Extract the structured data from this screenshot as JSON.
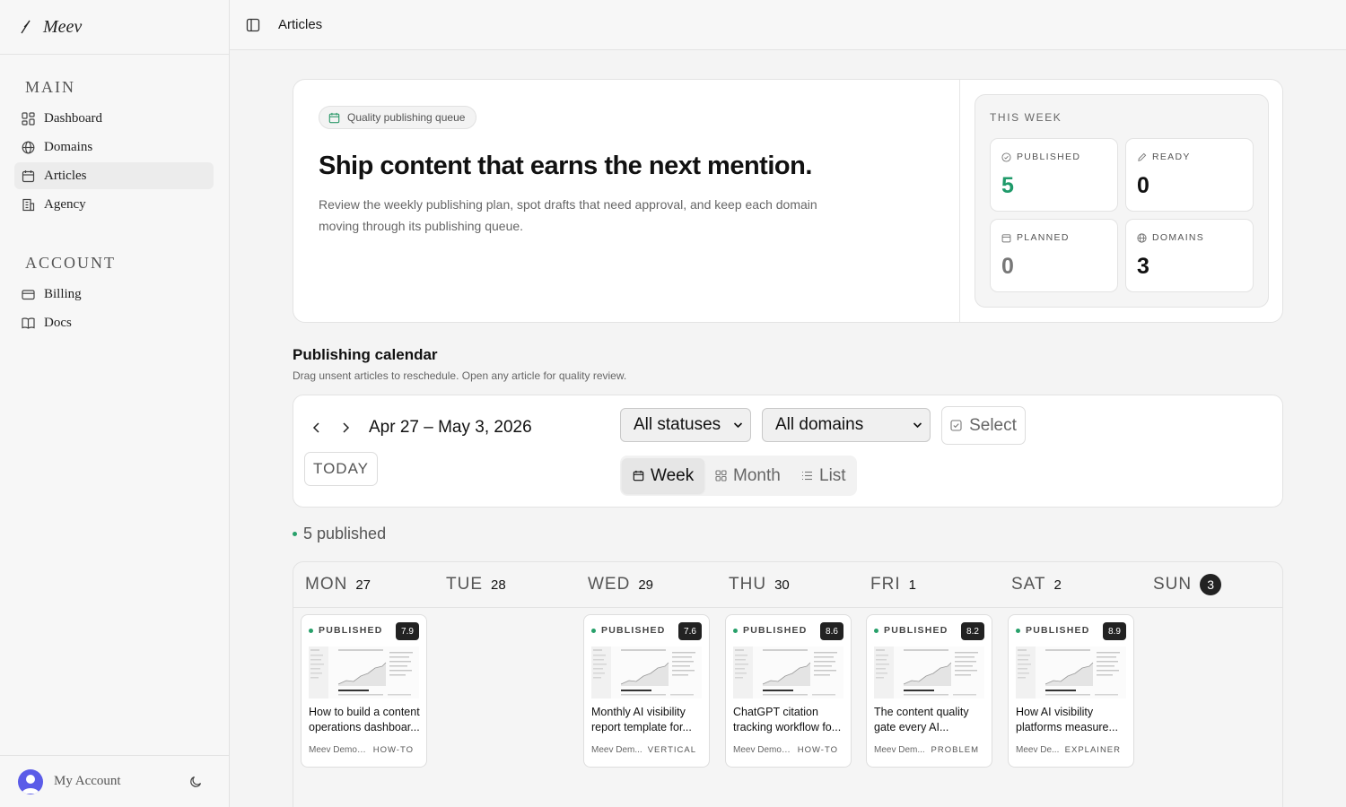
{
  "brand": {
    "name": "Meev"
  },
  "sidebar": {
    "sections": [
      {
        "title": "MAIN",
        "items": [
          {
            "label": "Dashboard",
            "icon": "dashboard-icon"
          },
          {
            "label": "Domains",
            "icon": "globe-icon"
          },
          {
            "label": "Articles",
            "icon": "calendar-icon",
            "active": true
          },
          {
            "label": "Agency",
            "icon": "building-icon"
          }
        ]
      },
      {
        "title": "ACCOUNT",
        "items": [
          {
            "label": "Billing",
            "icon": "credit-card-icon"
          },
          {
            "label": "Docs",
            "icon": "book-icon"
          }
        ]
      }
    ],
    "account_label": "My Account"
  },
  "topbar": {
    "title": "Articles"
  },
  "hero": {
    "badge": "Quality publishing queue",
    "title": "Ship content that earns the next mention.",
    "description": "Review the weekly publishing plan, spot drafts that need approval, and keep each domain moving through its publishing queue.",
    "week_label": "THIS WEEK",
    "stats": [
      {
        "label": "PUBLISHED",
        "value": "5",
        "color": "#1f9a6a",
        "icon": "check-circle-icon"
      },
      {
        "label": "READY",
        "value": "0",
        "color": "#111111",
        "icon": "pencil-icon"
      },
      {
        "label": "PLANNED",
        "value": "0",
        "color": "#777777",
        "icon": "calendar-icon"
      },
      {
        "label": "DOMAINS",
        "value": "3",
        "color": "#111111",
        "icon": "globe-icon"
      }
    ]
  },
  "calendar": {
    "title": "Publishing calendar",
    "subtitle": "Drag unsent articles to reschedule. Open any article for quality review.",
    "range": "Apr 27 – May 3, 2026",
    "today_label": "TODAY",
    "status_filter": "All statuses",
    "domain_filter": "All domains",
    "select_label": "Select",
    "views": [
      {
        "label": "Week",
        "active": true,
        "icon": "calendar-icon"
      },
      {
        "label": "Month",
        "active": false,
        "icon": "grid-icon"
      },
      {
        "label": "List",
        "active": false,
        "icon": "list-icon"
      }
    ],
    "published_count": "5 published",
    "accent": "#27a06a",
    "days": [
      {
        "name": "MON",
        "num": "27"
      },
      {
        "name": "TUE",
        "num": "28"
      },
      {
        "name": "WED",
        "num": "29"
      },
      {
        "name": "THU",
        "num": "30"
      },
      {
        "name": "FRI",
        "num": "1"
      },
      {
        "name": "SAT",
        "num": "2"
      },
      {
        "name": "SUN",
        "num": "3",
        "today": true
      }
    ],
    "cards": [
      {
        "day": "MON",
        "status": "PUBLISHED",
        "score": "7.9",
        "title": "How to build a content operations dashboar...",
        "domain": "Meev Demo ...",
        "type": "HOW-TO"
      },
      {
        "day": "WED",
        "status": "PUBLISHED",
        "score": "7.6",
        "title": "Monthly AI visibility report template for...",
        "domain": "Meev Dem...",
        "type": "VERTICAL"
      },
      {
        "day": "THU",
        "status": "PUBLISHED",
        "score": "8.6",
        "title": "ChatGPT citation tracking workflow fo...",
        "domain": "Meev Demo ...",
        "type": "HOW-TO"
      },
      {
        "day": "FRI",
        "status": "PUBLISHED",
        "score": "8.2",
        "title": "The content quality gate every AI...",
        "domain": "Meev Dem...",
        "type": "PROBLEM"
      },
      {
        "day": "SAT",
        "status": "PUBLISHED",
        "score": "8.9",
        "title": "How AI visibility platforms measure...",
        "domain": "Meev De...",
        "type": "EXPLAINER"
      }
    ]
  }
}
